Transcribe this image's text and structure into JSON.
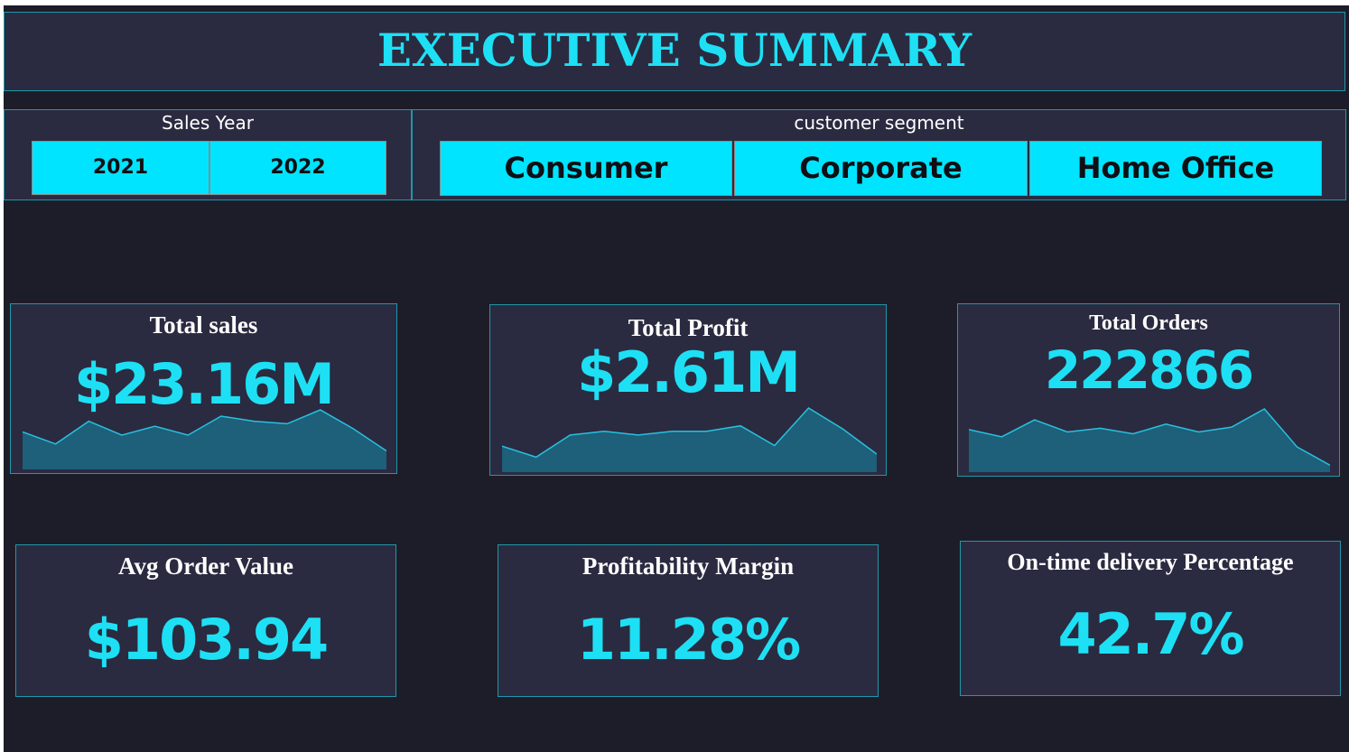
{
  "header": {
    "title": "EXECUTIVE SUMMARY"
  },
  "filters": {
    "sales_year": {
      "title": "Sales Year",
      "options": [
        "2021",
        "2022"
      ]
    },
    "customer_segment": {
      "title": "customer segment",
      "options": [
        "Consumer",
        "Corporate",
        "Home Office"
      ]
    }
  },
  "kpis": {
    "total_sales": {
      "label": "Total sales",
      "value": "$23.16M"
    },
    "total_profit": {
      "label": "Total Profit",
      "value": "$2.61M"
    },
    "total_orders": {
      "label": "Total Orders",
      "value": "222866"
    },
    "avg_order_value": {
      "label": "Avg Order Value",
      "value": "$103.94"
    },
    "profitability_margin": {
      "label": "Profitability Margin",
      "value": "11.28%"
    },
    "on_time_delivery": {
      "label": "On-time delivery Percentage",
      "value": "42.7%"
    }
  },
  "sparklines": {
    "total_sales": [
      0.55,
      0.36,
      0.72,
      0.5,
      0.64,
      0.5,
      0.8,
      0.72,
      0.68,
      0.9,
      0.6,
      0.25
    ],
    "total_profit": [
      0.38,
      0.2,
      0.56,
      0.62,
      0.56,
      0.62,
      0.62,
      0.71,
      0.39,
      1.0,
      0.66,
      0.25
    ],
    "total_orders": [
      0.66,
      0.54,
      0.82,
      0.62,
      0.68,
      0.59,
      0.75,
      0.62,
      0.7,
      1.0,
      0.37,
      0.07
    ]
  },
  "colors": {
    "background": "#1d1d29",
    "card": "#2a2b40",
    "border": "#1f97aa",
    "accent": "#1ee0f5",
    "button": "#00e4ff",
    "sparkline_fill": "#1e5f79",
    "sparkline_line": "#27c1e0"
  }
}
